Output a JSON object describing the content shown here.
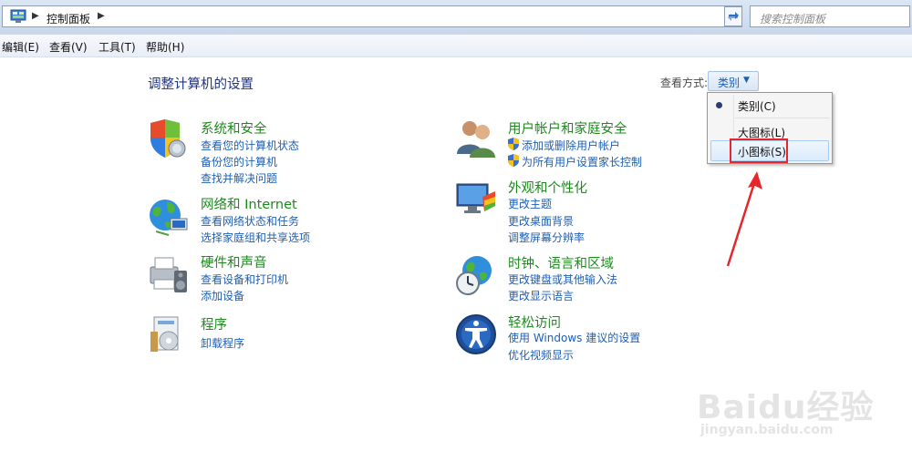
{
  "address_bar": {
    "breadcrumb": "控制面板",
    "search_placeholder": "搜索控制面板"
  },
  "menu_bar": [
    {
      "label": "编辑(E)"
    },
    {
      "label": "查看(V)"
    },
    {
      "label": "工具(T)"
    },
    {
      "label": "帮助(H)"
    }
  ],
  "main": {
    "heading": "调整计算机的设置",
    "view_by_label": "查看方式:",
    "view_by_value": "类别"
  },
  "view_menu": {
    "items": [
      {
        "label": "类别(C)",
        "selected": true
      },
      {
        "label": "大图标(L)",
        "selected": false
      },
      {
        "label": "小图标(S)",
        "selected": false,
        "highlighted": true
      }
    ]
  },
  "categories_left": [
    {
      "title": "系统和安全",
      "icon": "shield-icon",
      "links": [
        "查看您的计算机状态",
        "备份您的计算机",
        "查找并解决问题"
      ]
    },
    {
      "title": "网络和 Internet",
      "icon": "network-globe-icon",
      "links": [
        "查看网络状态和任务",
        "选择家庭组和共享选项"
      ]
    },
    {
      "title": "硬件和声音",
      "icon": "printer-speaker-icon",
      "links": [
        "查看设备和打印机",
        "添加设备"
      ]
    },
    {
      "title": "程序",
      "icon": "programs-icon",
      "links": [
        "卸载程序"
      ]
    }
  ],
  "categories_right": [
    {
      "title": "用户帐户和家庭安全",
      "icon": "users-icon",
      "links": [
        "添加或删除用户帐户",
        "为所有用户设置家长控制"
      ]
    },
    {
      "title": "外观和个性化",
      "icon": "monitor-paint-icon",
      "links": [
        "更改主题",
        "更改桌面背景",
        "调整屏幕分辨率"
      ]
    },
    {
      "title": "时钟、语言和区域",
      "icon": "clock-globe-icon",
      "links": [
        "更改键盘或其他输入法",
        "更改显示语言"
      ]
    },
    {
      "title": "轻松访问",
      "icon": "ease-of-access-icon",
      "links": [
        "使用 Windows 建议的设置",
        "优化视频显示"
      ]
    }
  ],
  "watermark": {
    "brand": "Baidu经验",
    "url": "jingyan.baidu.com"
  },
  "colors": {
    "category_title": "#1e8a1e",
    "link": "#1e5fb4",
    "heading": "#1e3287",
    "annotation_red": "#e8262a"
  }
}
